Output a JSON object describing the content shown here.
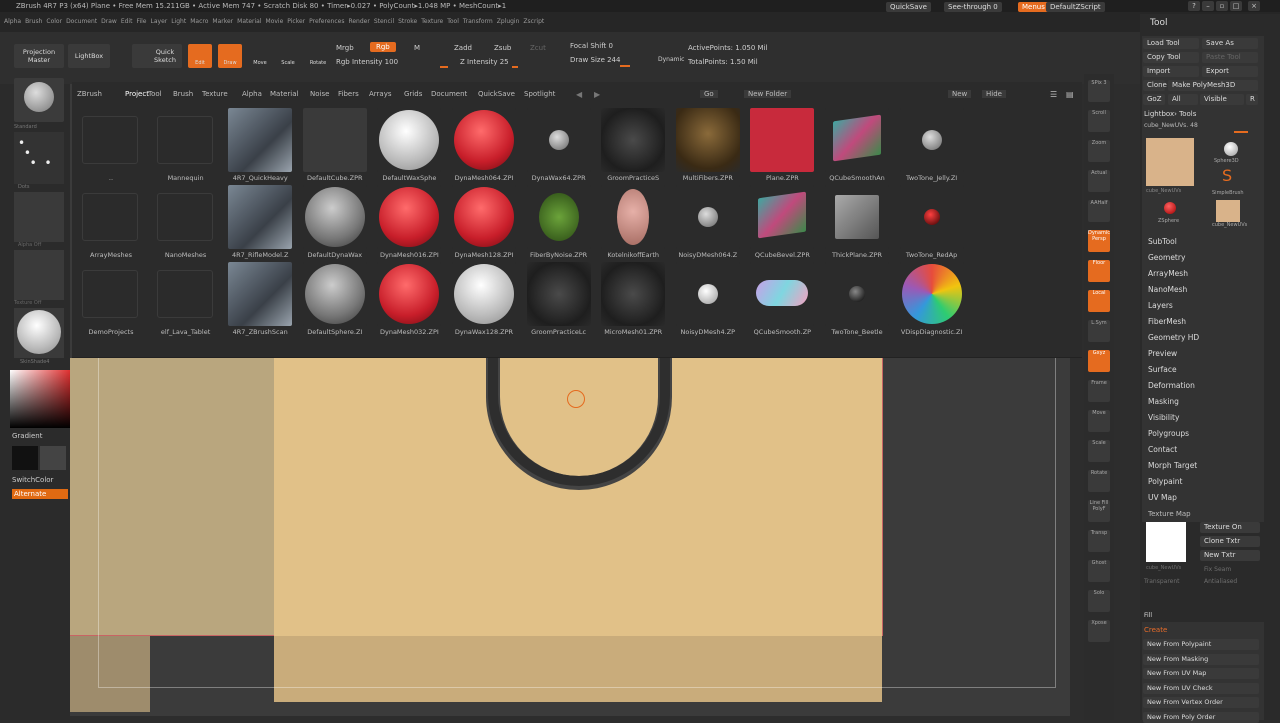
{
  "titlebar": {
    "text": "ZBrush 4R7 P3 (x64)    Plane      • Free Mem 15.211GB • Active Mem 747 • Scratch Disk 80 • Timer▸0.027 • PolyCount▸1.048 MP    • MeshCount▸1",
    "quicksave": "QuickSave",
    "seethrough": "See-through   0",
    "menus": "Menus",
    "defaultzscript": "DefaultZScript"
  },
  "menubar": [
    "Alpha",
    "Brush",
    "Color",
    "Document",
    "Draw",
    "Edit",
    "File",
    "Layer",
    "Light",
    "Macro",
    "Marker",
    "Material",
    "Movie",
    "Picker",
    "Preferences",
    "Render",
    "Stencil",
    "Stroke",
    "Texture",
    "Tool",
    "Transform",
    "Zplugin",
    "Zscript"
  ],
  "toolbar": {
    "projection_master": "Projection Master",
    "lightbox": "LightBox",
    "quick_sketch": "Quick Sketch",
    "edit": "Edit",
    "draw": "Draw",
    "move": "Move",
    "scale": "Scale",
    "rotate": "Rotate",
    "mrgb": "Mrgb",
    "rgb": "Rgb",
    "m": "M",
    "rgb_intensity": "Rgb Intensity 100",
    "zadd": "Zadd",
    "zsub": "Zsub",
    "zcut": "Zcut",
    "z_intensity": "Z Intensity 25",
    "focal_shift": "Focal Shift 0",
    "draw_size": "Draw Size 244",
    "dynamic": "Dynamic",
    "active_points": "ActivePoints: 1.050  Mil",
    "total_points": "TotalPoints: 1.50  Mil"
  },
  "lightbox": {
    "tabs": [
      "ZBrush",
      "Project",
      "Tool",
      "Brush",
      "Texture",
      "Alpha",
      "Material",
      "Noise",
      "Fibers",
      "Arrays",
      "Grids",
      "Document",
      "QuickSave",
      "Spotlight"
    ],
    "active_tab": "Project",
    "go": "Go",
    "new_folder": "New Folder",
    "new": "New",
    "hide": "Hide",
    "rows": [
      [
        "..",
        "Mannequin",
        "4R7_QuickHeavy",
        "DefaultCube.ZPR",
        "DefaultWaxSphe",
        "DynaMesh064.ZPI",
        "DynaWax64.ZPR",
        "GroomPracticeS",
        "MultiFibers.ZPR",
        "Plane.ZPR",
        "QCubeSmoothAn",
        "TwoTone_Jelly.ZI"
      ],
      [
        "ArrayMeshes",
        "NanoMeshes",
        "4R7_RifleModel.Z",
        "DefaultDynaWax",
        "DynaMesh016.ZPI",
        "DynaMesh128.ZPI",
        "FiberByNoise.ZPR",
        "KotelnikoffEarth",
        "NoisyDMesh064.Z",
        "QCubeBevel.ZPR",
        "ThickPlane.ZPR",
        "TwoTone_RedAp"
      ],
      [
        "DemoProjects",
        "elf_Lava_Tablet",
        "4R7_ZBrushScan",
        "DefaultSphere.ZI",
        "DynaMesh032.ZPI",
        "DynaWax128.ZPR",
        "GroomPracticeLc",
        "MicroMesh01.ZPR",
        "NoisyDMesh4.ZP",
        "QCubeSmooth.ZP",
        "TwoTone_Beetle",
        "VDispDiagnostic.ZI"
      ]
    ]
  },
  "leftshelf": {
    "standard": "Standard",
    "dots": "Dots",
    "alpha_off": "Alpha Off",
    "texture_off": "Texture Off",
    "skinshade": "SkinShade4",
    "gradient": "Gradient",
    "switchcolor": "SwitchColor",
    "alternate": "Alternate"
  },
  "rightshelf": [
    "SPix 3",
    "Scroll",
    "Zoom",
    "Actual",
    "AAHalf",
    "Dynamic Persp",
    "Floor",
    "Local",
    "L.Sym",
    "Gxyz",
    "Frame",
    "Move",
    "Scale",
    "Rotate",
    "Line Fill PolyF",
    "Transp",
    "Ghost",
    "Solo",
    "Xpose"
  ],
  "toolpanel": {
    "title": "Tool",
    "load_tool": "Load Tool",
    "save_as": "Save As",
    "copy_tool": "Copy Tool",
    "paste_tool": "Paste Tool",
    "import": "Import",
    "export": "Export",
    "clone": "Clone",
    "make_polymesh": "Make PolyMesh3D",
    "goz": "GoZ",
    "all": "All",
    "visible": "Visible",
    "r": "R",
    "lightbox_tools": "Lightbox› Tools",
    "current_tool": "cube_NewUVs. 48",
    "thumbs": [
      "cube_NewUVs",
      "Sphere3D",
      "SimpleBrush",
      "ZSphere",
      "cube_NewUVs"
    ],
    "sections": [
      "SubTool",
      "Geometry",
      "ArrayMesh",
      "NanoMesh",
      "Layers",
      "FiberMesh",
      "Geometry HD",
      "Preview",
      "Surface",
      "Deformation",
      "Masking",
      "Visibility",
      "Polygroups",
      "Contact",
      "Morph Target",
      "Polypaint",
      "UV Map"
    ],
    "texture_map": "Texture Map",
    "texture_on": "Texture On",
    "clone_txtr": "Clone Txtr",
    "new_txtr": "New Txtr",
    "fix_seam": "Fix Seam",
    "transparent": "Transparent",
    "antialiased": "Antialiased",
    "tex_name": "cube_NewUVs",
    "fill": "Fill",
    "create": "Create",
    "create_items": [
      "New From Polypaint",
      "New From Masking",
      "New From UV Map",
      "New From UV Check",
      "New From Vertex Order",
      "New From Poly Order"
    ]
  },
  "colors": {
    "accent": "#e56b1f",
    "alternate": "#e06a12",
    "parchment": "#e1c188"
  }
}
